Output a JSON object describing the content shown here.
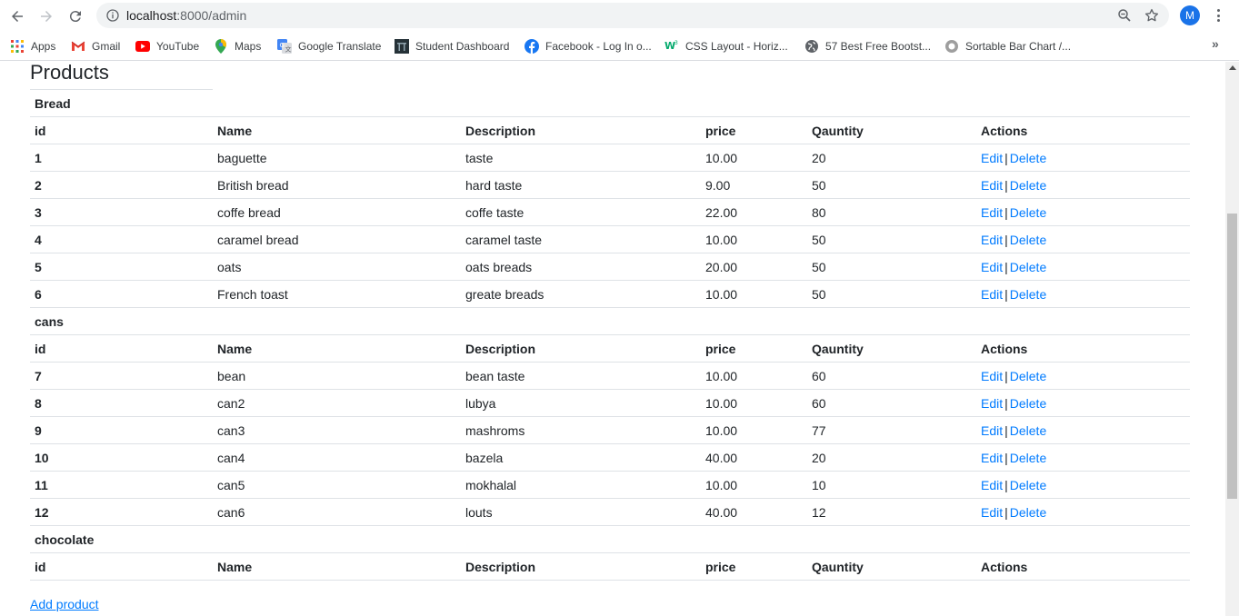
{
  "browser": {
    "url_host": "localhost",
    "url_path": ":8000/admin",
    "profile_initial": "M"
  },
  "bookmarks": [
    {
      "label": "Apps",
      "icon": "apps-grid-icon"
    },
    {
      "label": "Gmail",
      "icon": "gmail-icon"
    },
    {
      "label": "YouTube",
      "icon": "youtube-icon"
    },
    {
      "label": "Maps",
      "icon": "maps-icon"
    },
    {
      "label": "Google Translate",
      "icon": "translate-icon"
    },
    {
      "label": "Student Dashboard",
      "icon": "dashboard-icon"
    },
    {
      "label": "Facebook - Log In o...",
      "icon": "facebook-icon"
    },
    {
      "label": "CSS Layout - Horiz...",
      "icon": "w3schools-icon"
    },
    {
      "label": "57 Best Free Bootst...",
      "icon": "globe-icon"
    },
    {
      "label": "Sortable Bar Chart /...",
      "icon": "circle-icon"
    }
  ],
  "page": {
    "title": "Products",
    "add_product": "Add product",
    "columns": {
      "id": "id",
      "name": "Name",
      "description": "Description",
      "price": "price",
      "quantity": "Qauntity",
      "actions": "Actions"
    },
    "edit_label": "Edit",
    "separator": "|",
    "delete_label": "Delete"
  },
  "categories": [
    {
      "name": "Bread",
      "products": [
        {
          "id": "1",
          "name": "baguette",
          "description": "taste",
          "price": "10.00",
          "quantity": "20"
        },
        {
          "id": "2",
          "name": "British bread",
          "description": "hard taste",
          "price": "9.00",
          "quantity": "50"
        },
        {
          "id": "3",
          "name": "coffe bread",
          "description": "coffe taste",
          "price": "22.00",
          "quantity": "80"
        },
        {
          "id": "4",
          "name": "caramel bread",
          "description": "caramel taste",
          "price": "10.00",
          "quantity": "50"
        },
        {
          "id": "5",
          "name": "oats",
          "description": "oats breads",
          "price": "20.00",
          "quantity": "50"
        },
        {
          "id": "6",
          "name": "French toast",
          "description": "greate breads",
          "price": "10.00",
          "quantity": "50"
        }
      ]
    },
    {
      "name": "cans",
      "products": [
        {
          "id": "7",
          "name": "bean",
          "description": "bean taste",
          "price": "10.00",
          "quantity": "60"
        },
        {
          "id": "8",
          "name": "can2",
          "description": "lubya",
          "price": "10.00",
          "quantity": "60"
        },
        {
          "id": "9",
          "name": "can3",
          "description": "mashroms",
          "price": "10.00",
          "quantity": "77"
        },
        {
          "id": "10",
          "name": "can4",
          "description": "bazela",
          "price": "40.00",
          "quantity": "20"
        },
        {
          "id": "11",
          "name": "can5",
          "description": "mokhalal",
          "price": "10.00",
          "quantity": "10"
        },
        {
          "id": "12",
          "name": "can6",
          "description": "louts",
          "price": "40.00",
          "quantity": "12"
        }
      ]
    },
    {
      "name": "chocolate",
      "products": []
    }
  ]
}
